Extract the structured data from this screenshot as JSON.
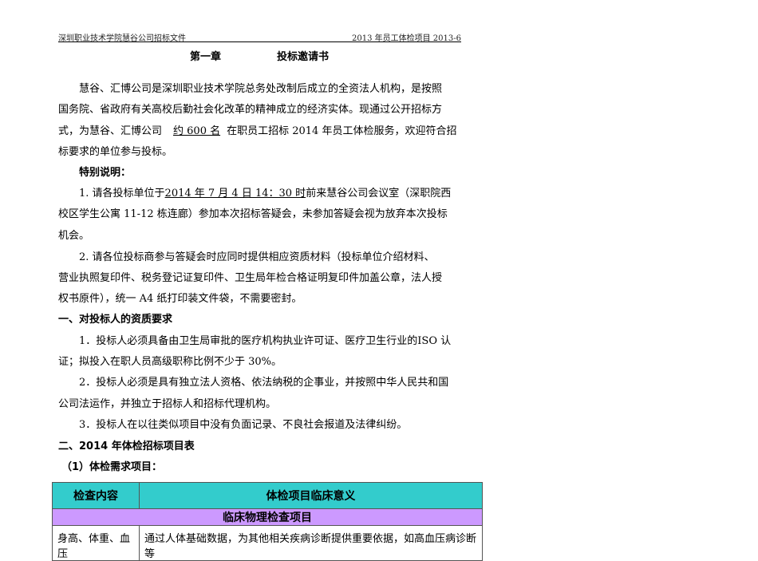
{
  "header": {
    "left": "深圳职业技术学院慧谷公司招标文件",
    "right": "2013 年员工体检项目    2013-6"
  },
  "title": {
    "chapter": "第一章",
    "name": "投标邀请书"
  },
  "intro": [
    "慧谷、汇博公司是深圳职业技术学院总务处改制后成立的全资法人机构，是按照",
    "国务院、省政府有关高校后勤社会化改革的精神成立的经济实体。现通过公开招标方",
    "式，为慧谷、汇博公司",
    "约 600  名",
    "在职员工招标 2014 年员工体检服务，欢迎符合招",
    "标要求的单位参与投标。"
  ],
  "special": {
    "heading": "特别说明：",
    "item1": [
      "1.   请各投标单位于",
      "2014 年 7 月  4 日  14：30 时",
      "前来慧谷公司会议室（深职院西",
      "校区学生公寓 11-12 栋连廊）参加本次招标答疑会，未参加答疑会视为放弃本次投标",
      "机会。"
    ],
    "item2": [
      "2.   请各位投标商参与答疑会时应同时提供相应资质材料（投标单位介绍材料、",
      "营业执照复印件、税务登记证复印件、卫生局年检合格证明复印件加盖公章，法人授",
      "权书原件），统一 A4 纸打印装文件袋，不需要密封。"
    ]
  },
  "section1": {
    "heading": "一、对投标人的资质要求",
    "items": [
      "1．投标人必须具备由卫生局审批的医疗机构执业许可证、医疗卫生行业的ISO 认",
      "证；拟投入在职人员高级职称比例不少于 30%。",
      "2．投标人必须是具有独立法人资格、依法纳税的企事业，并按照中华人民共和国",
      "公司法运作，并独立于招标人和招标代理机构。",
      "3．投标人在以往类似项目中没有负面记录、不良社会报道及法律纠纷。"
    ]
  },
  "section2": {
    "heading": "二、2014 年体检招标项目表",
    "sub": "（1）体检需求项目："
  },
  "table": {
    "col1": "检查内容",
    "col2": "体检项目临床意义",
    "group": "临床物理检查项目",
    "rows": [
      {
        "item": "身高、体重、血压",
        "meaning": "通过人体基础数据，为其他相关疾病诊断提供重要依据，如高血压病诊断等"
      }
    ]
  }
}
